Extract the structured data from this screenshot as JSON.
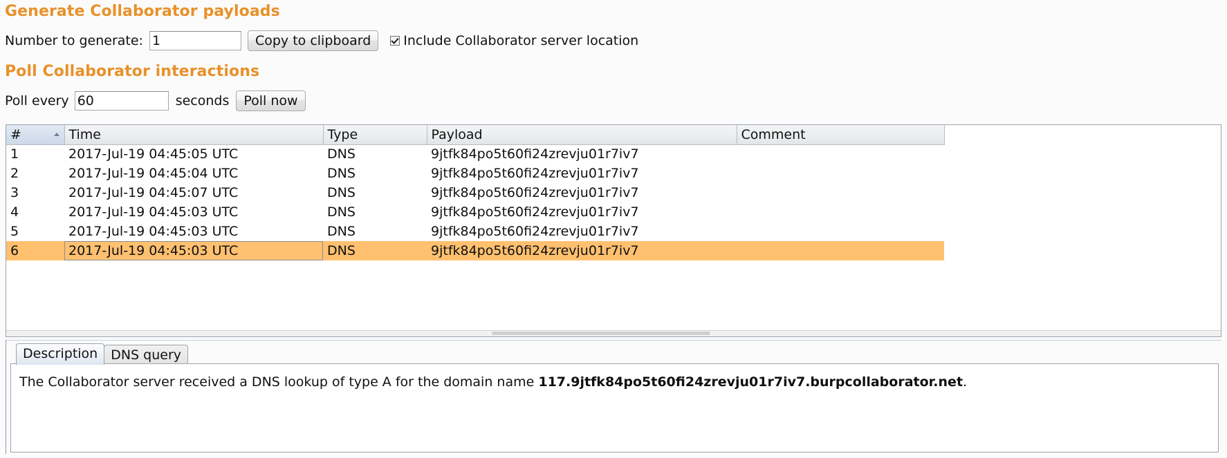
{
  "generate": {
    "heading": "Generate Collaborator payloads",
    "number_label": "Number to generate:",
    "number_value": "1",
    "copy_button": "Copy to clipboard",
    "include_location_label": "Include Collaborator server location",
    "include_location_checked": true
  },
  "poll": {
    "heading": "Poll Collaborator interactions",
    "every_label": "Poll every",
    "interval_value": "60",
    "seconds_label": "seconds",
    "poll_now_button": "Poll now"
  },
  "table": {
    "columns": [
      "#",
      "Time",
      "Type",
      "Payload",
      "Comment"
    ],
    "sort_column": "#",
    "sort_direction": "ascending",
    "selected_row_index": 5,
    "rows": [
      {
        "num": "1",
        "time": "2017-Jul-19 04:45:05 UTC",
        "type": "DNS",
        "payload": "9jtfk84po5t60fi24zrevju01r7iv7",
        "comment": ""
      },
      {
        "num": "2",
        "time": "2017-Jul-19 04:45:04 UTC",
        "type": "DNS",
        "payload": "9jtfk84po5t60fi24zrevju01r7iv7",
        "comment": ""
      },
      {
        "num": "3",
        "time": "2017-Jul-19 04:45:07 UTC",
        "type": "DNS",
        "payload": "9jtfk84po5t60fi24zrevju01r7iv7",
        "comment": ""
      },
      {
        "num": "4",
        "time": "2017-Jul-19 04:45:03 UTC",
        "type": "DNS",
        "payload": "9jtfk84po5t60fi24zrevju01r7iv7",
        "comment": ""
      },
      {
        "num": "5",
        "time": "2017-Jul-19 04:45:03 UTC",
        "type": "DNS",
        "payload": "9jtfk84po5t60fi24zrevju01r7iv7",
        "comment": ""
      },
      {
        "num": "6",
        "time": "2017-Jul-19 04:45:03 UTC",
        "type": "DNS",
        "payload": "9jtfk84po5t60fi24zrevju01r7iv7",
        "comment": ""
      }
    ]
  },
  "details": {
    "tabs": [
      {
        "label": "Description",
        "active": true
      },
      {
        "label": "DNS query",
        "active": false
      }
    ],
    "description_prefix": "The Collaborator server received a DNS lookup of type A for the domain name ",
    "description_domain": "117.9jtfk84po5t60fi24zrevju01r7iv7.burpcollaborator.net",
    "description_suffix": "."
  },
  "colors": {
    "heading": "#e8912a",
    "selection": "#ffc070",
    "panel_border": "#9aa3ad"
  }
}
